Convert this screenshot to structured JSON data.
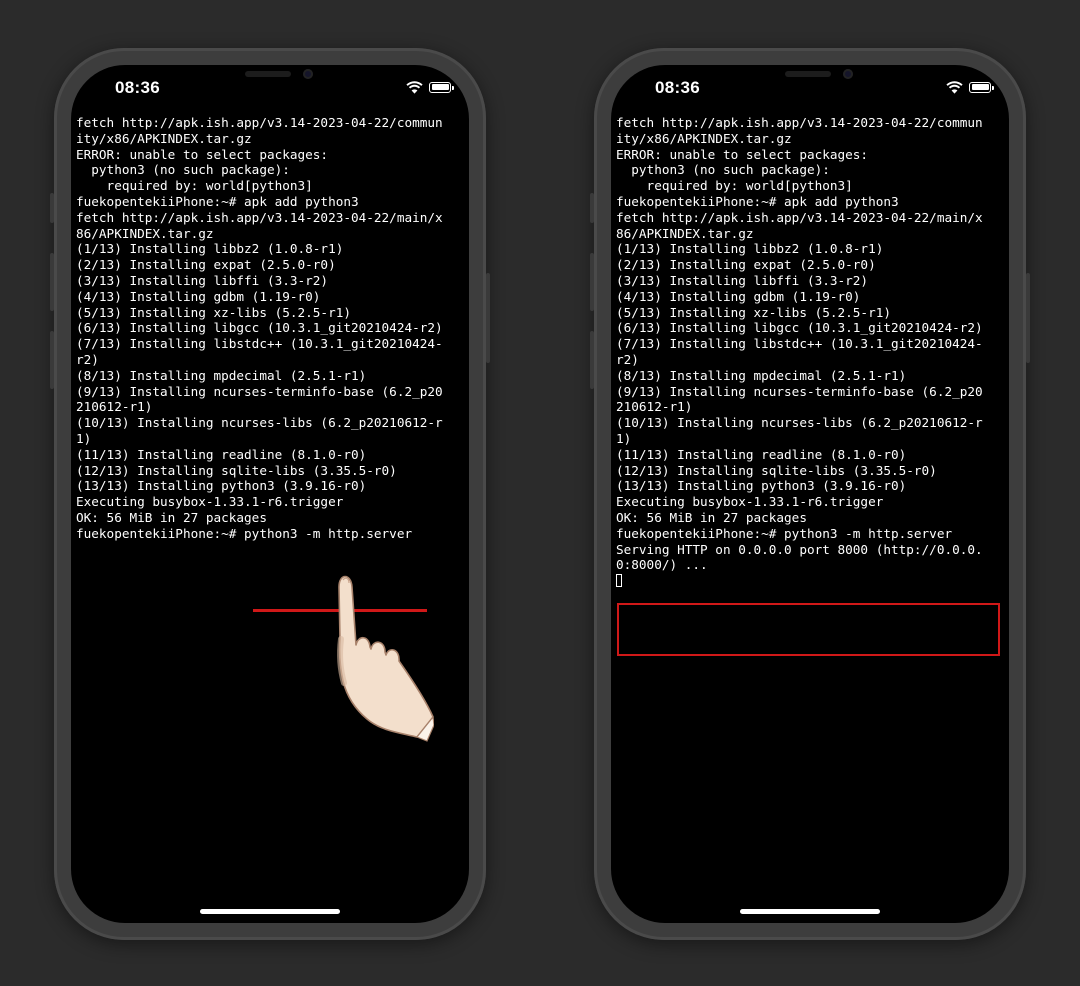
{
  "status_bar": {
    "time": "08:36"
  },
  "terminal_lines": [
    "fetch http://apk.ish.app/v3.14-2023-04-22/commun",
    "ity/x86/APKINDEX.tar.gz",
    "ERROR: unable to select packages:",
    "  python3 (no such package):",
    "    required by: world[python3]",
    "fuekopentekiiPhone:~# apk add python3",
    "fetch http://apk.ish.app/v3.14-2023-04-22/main/x",
    "86/APKINDEX.tar.gz",
    "(1/13) Installing libbz2 (1.0.8-r1)",
    "(2/13) Installing expat (2.5.0-r0)",
    "(3/13) Installing libffi (3.3-r2)",
    "(4/13) Installing gdbm (1.19-r0)",
    "(5/13) Installing xz-libs (5.2.5-r1)",
    "(6/13) Installing libgcc (10.3.1_git20210424-r2)",
    "(7/13) Installing libstdc++ (10.3.1_git20210424-",
    "r2)",
    "(8/13) Installing mpdecimal (2.5.1-r1)",
    "(9/13) Installing ncurses-terminfo-base (6.2_p20",
    "210612-r1)",
    "(10/13) Installing ncurses-libs (6.2_p20210612-r",
    "1)",
    "(11/13) Installing readline (8.1.0-r0)",
    "(12/13) Installing sqlite-libs (3.35.5-r0)",
    "(13/13) Installing python3 (3.9.16-r0)",
    "Executing busybox-1.33.1-r6.trigger",
    "OK: 56 MiB in 27 packages",
    "fuekopentekiiPhone:~# python3 -m http.server"
  ],
  "server_output": [
    "Serving HTTP on 0.0.0.0 port 8000 (http://0.0.0.",
    "0:8000/) ..."
  ],
  "highlight_color": "#d01818",
  "icons": [
    "wifi-icon",
    "battery-icon",
    "pointing-hand-icon"
  ]
}
